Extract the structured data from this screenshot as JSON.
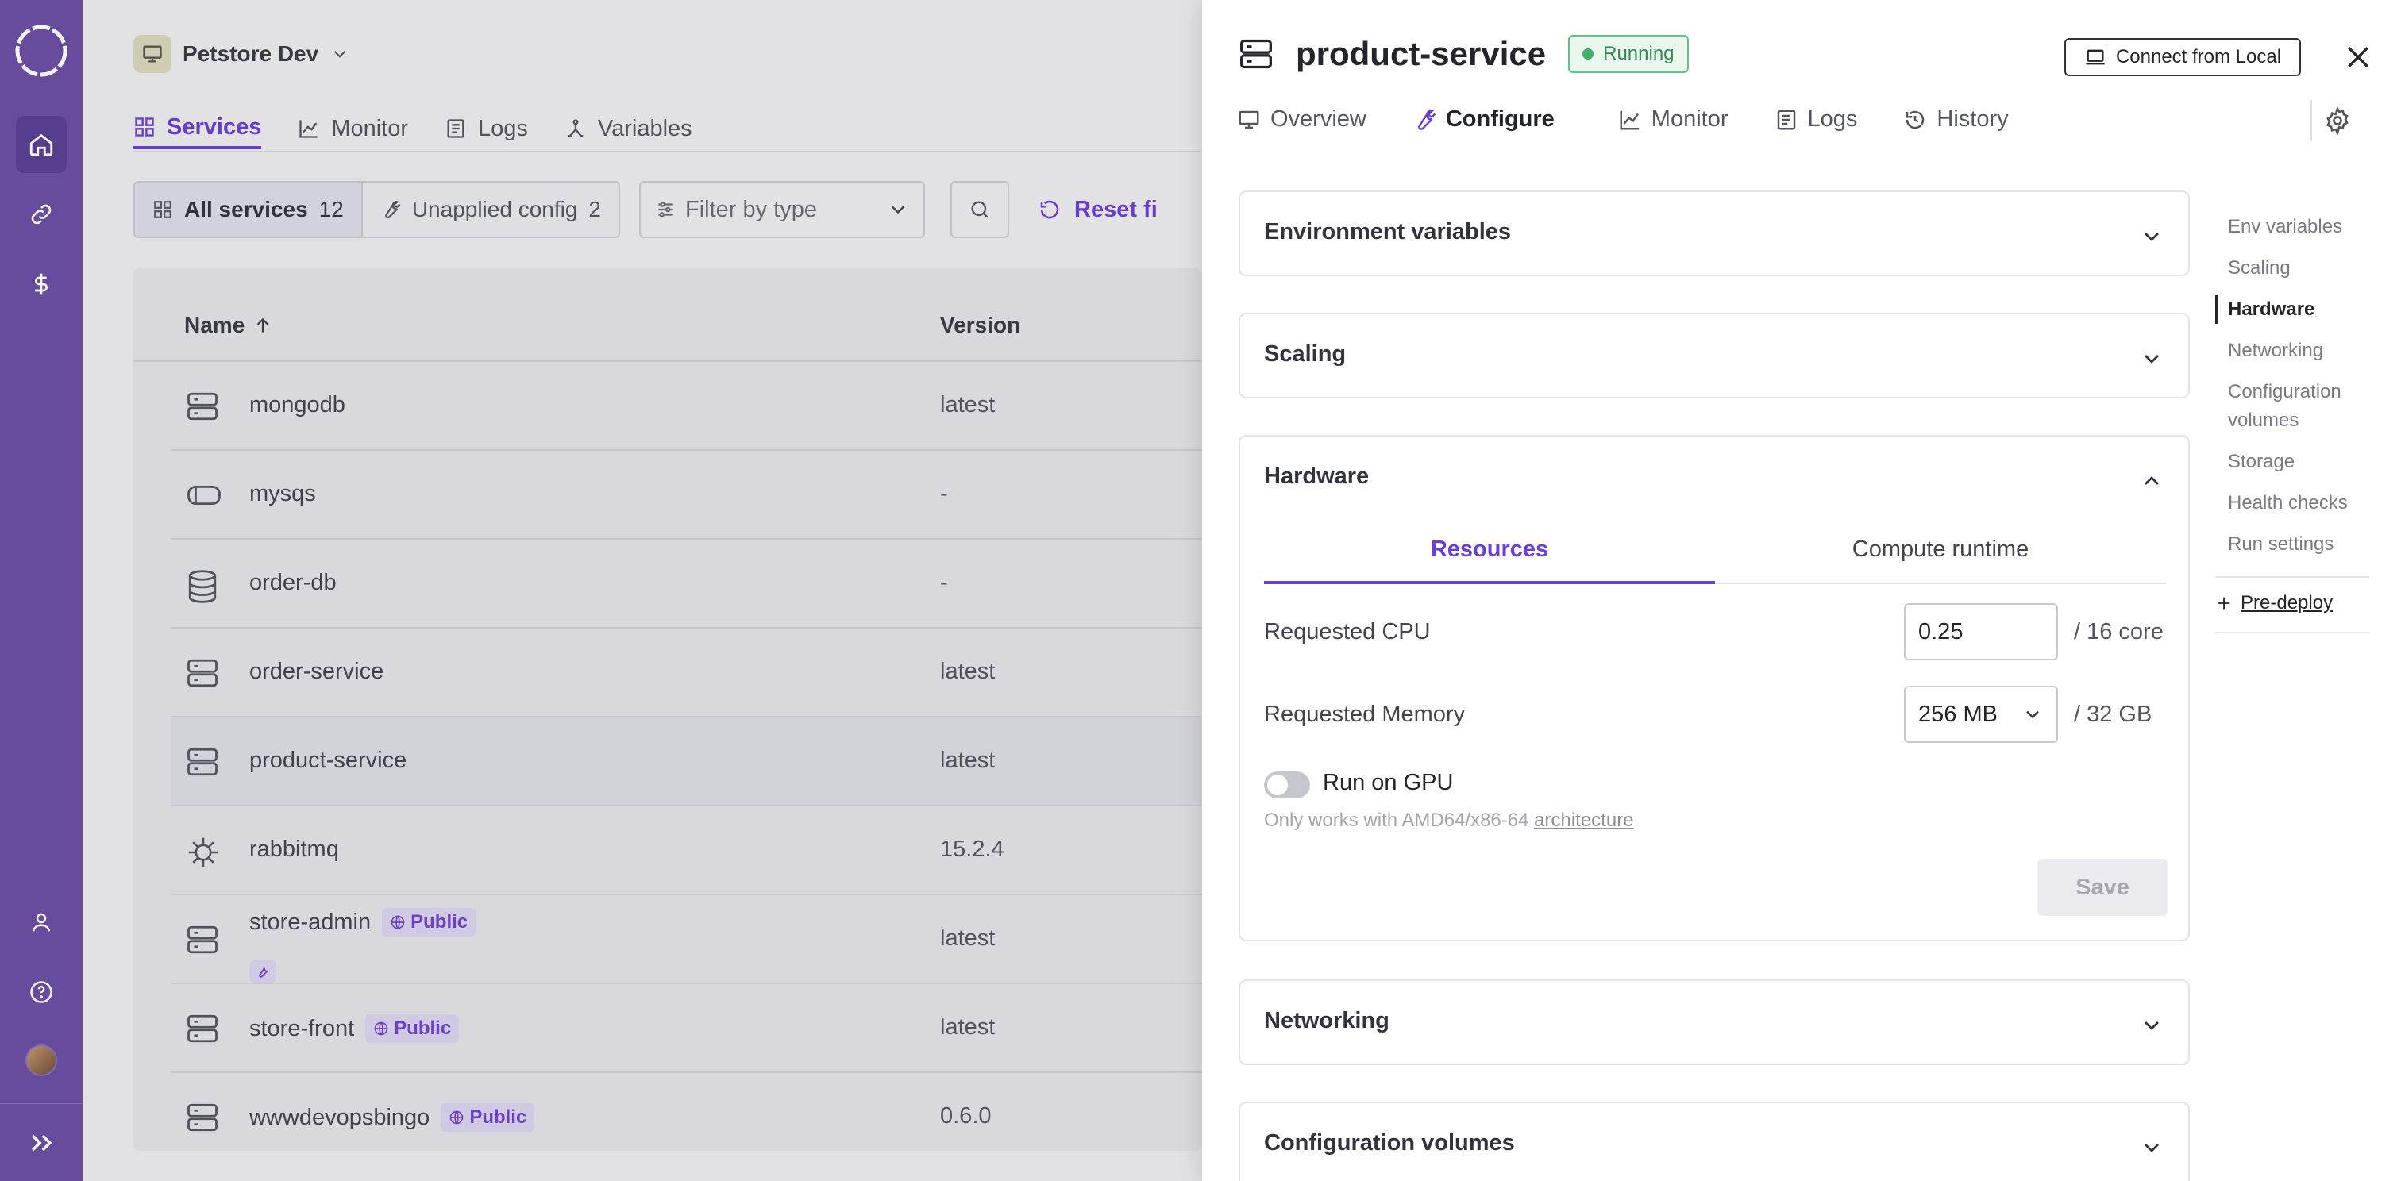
{
  "colors": {
    "rail": "#6b4fa3",
    "accent": "#6b3fd4",
    "running": "#3bb36a"
  },
  "project": {
    "name": "Petstore Dev"
  },
  "left_tabs": [
    {
      "label": "Services",
      "icon": "grid-icon",
      "active": true
    },
    {
      "label": "Monitor",
      "icon": "chart-icon",
      "active": false
    },
    {
      "label": "Logs",
      "icon": "document-icon",
      "active": false
    },
    {
      "label": "Variables",
      "icon": "variables-icon",
      "active": false
    }
  ],
  "filters": {
    "all_services": "All services",
    "all_services_count": "12",
    "unapplied": "Unapplied config",
    "unapplied_count": "2",
    "type_placeholder": "Filter by type",
    "reset": "Reset fi"
  },
  "table": {
    "col_name": "Name",
    "col_version": "Version",
    "rows": [
      {
        "name": "mongodb",
        "version": "latest",
        "icon": "server-icon"
      },
      {
        "name": "mysqs",
        "version": "-",
        "icon": "disk-icon"
      },
      {
        "name": "order-db",
        "version": "-",
        "icon": "database-icon"
      },
      {
        "name": "order-service",
        "version": "latest",
        "icon": "server-icon"
      },
      {
        "name": "product-service",
        "version": "latest",
        "icon": "server-icon",
        "selected": true
      },
      {
        "name": "rabbitmq",
        "version": "15.2.4",
        "icon": "helm-icon"
      },
      {
        "name": "store-admin",
        "version": "latest",
        "icon": "server-icon",
        "badge": "Public",
        "wrench": true
      },
      {
        "name": "store-front",
        "version": "latest",
        "icon": "server-icon",
        "badge": "Public"
      },
      {
        "name": "wwwdevopsbingo",
        "version": "0.6.0",
        "icon": "server-icon",
        "badge": "Public"
      }
    ]
  },
  "panel": {
    "title": "product-service",
    "status": "Running",
    "connect": "Connect from Local",
    "tabs": [
      {
        "label": "Overview",
        "icon": "monitor-icon"
      },
      {
        "label": "Configure",
        "icon": "wrench-icon",
        "active": true
      },
      {
        "label": "Monitor",
        "icon": "chart-icon"
      },
      {
        "label": "Logs",
        "icon": "document-icon"
      },
      {
        "label": "History",
        "icon": "history-icon"
      }
    ],
    "sections": {
      "env": "Environment variables",
      "scaling": "Scaling",
      "hardware": "Hardware",
      "networking": "Networking",
      "config_volumes": "Configuration volumes"
    },
    "hardware": {
      "tab_resources": "Resources",
      "tab_runtime": "Compute runtime",
      "cpu_label": "Requested CPU",
      "cpu_value": "0.25",
      "cpu_unit": "/ 16 core",
      "mem_label": "Requested Memory",
      "mem_value": "256 MB",
      "mem_unit": "/ 32 GB",
      "gpu_label": "Run on GPU",
      "gpu_enabled": false,
      "hint": "Only works with AMD64/x86-64",
      "hint_link": "architecture",
      "save": "Save"
    },
    "toc": [
      {
        "label": "Env variables"
      },
      {
        "label": "Scaling"
      },
      {
        "label": "Hardware",
        "active": true
      },
      {
        "label": "Networking"
      },
      {
        "label": "Configuration volumes"
      },
      {
        "label": "Storage"
      },
      {
        "label": "Health checks"
      },
      {
        "label": "Run settings"
      }
    ],
    "predeploy": "Pre-deploy"
  }
}
